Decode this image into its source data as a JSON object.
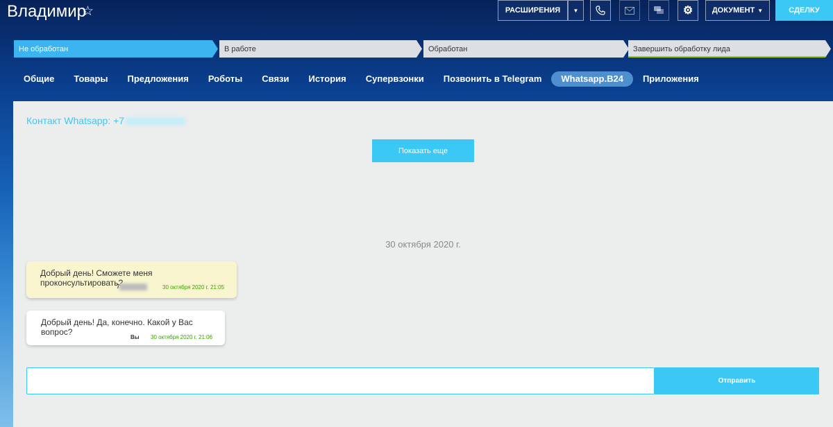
{
  "header": {
    "title": "Владимир",
    "star_icon": "☆",
    "extensions_label": "РАСШИРЕНИЯ",
    "document_label": "ДОКУМЕНТ",
    "deal_label": "СДЕЛКУ"
  },
  "stages": [
    {
      "label": "Не обработан"
    },
    {
      "label": "В работе"
    },
    {
      "label": "Обработан"
    },
    {
      "label": "Завершить обработку лида"
    }
  ],
  "tabs": [
    {
      "label": "Общие"
    },
    {
      "label": "Товары"
    },
    {
      "label": "Предложения"
    },
    {
      "label": "Роботы"
    },
    {
      "label": "Связи"
    },
    {
      "label": "История"
    },
    {
      "label": "Супервзонки"
    },
    {
      "label": "Позвонить в Telegram"
    },
    {
      "label": "Whatsapp.B24"
    },
    {
      "label": "Приложения"
    }
  ],
  "chat": {
    "contact_label": "Контакт Whatsapp: +7",
    "show_more_label": "Показать еще",
    "date_separator": "30 октября 2020 г.",
    "messages": [
      {
        "text": "Добрый день! Сможете меня проконсультировать?",
        "sender": "7",
        "time": "30 октября 2020 г. 21:05"
      },
      {
        "text": "Добрый день! Да, конечно. Какой у Вас вопрос?",
        "sender": "Вы",
        "time": "30 октября 2020 г. 21:06"
      }
    ],
    "input_value": "",
    "input_placeholder": "",
    "send_label": "Отправить"
  },
  "colors": {
    "accent": "#3bc8f5",
    "incoming_bubble": "#f9f6cf",
    "outgoing_bubble": "#ffffff",
    "timestamp": "#38a000",
    "active_stage": "#3bb4f0"
  },
  "icons": {
    "phone": "phone-icon",
    "mail": "mail-icon",
    "chat": "chat-icon",
    "gear": "gear-icon",
    "caret": "chevron-down-icon"
  }
}
